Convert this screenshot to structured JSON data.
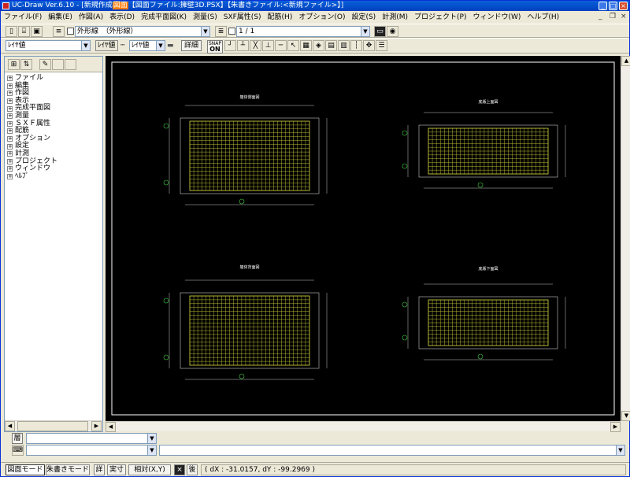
{
  "window": {
    "title_prefix": "UC-Draw Ver.6.10 - [新規作成",
    "title_highlight": "図面",
    "title_mid": "【図面ファイル:擁壁3D.PSX】【朱書きファイル:<新規ファイル>】]",
    "buttons": {
      "minimize": "_",
      "maximize": "□",
      "close": "×"
    }
  },
  "menubar": {
    "items": [
      "ファイル(F)",
      "編集(E)",
      "作図(A)",
      "表示(D)",
      "完成平面図(K)",
      "測量(S)",
      "SXF属性(S)",
      "配筋(H)",
      "オプション(O)",
      "設定(S)",
      "計測(M)",
      "プロジェクト(P)",
      "ウィンドウ(W)",
      "ヘルプ(H)"
    ],
    "mdi_buttons": [
      "_",
      "❐",
      "×"
    ]
  },
  "toolbar1": {
    "layer_combo": "外形線　（外形線）",
    "page_combo": "1 / 1"
  },
  "toolbar2": {
    "line_type_combo": "ﾚｲﾔ値",
    "label_layer": "ﾚｲﾔ値",
    "width_combo": "ﾚｲﾔ値",
    "detail_button": "詳細",
    "snap_label": "SNAP",
    "snap_state": "ON"
  },
  "tree": {
    "items": [
      "ファイル",
      "編集",
      "作図",
      "表示",
      "完成平面図",
      "測量",
      "ＳＸＦ属性",
      "配筋",
      "オプション",
      "設定",
      "計測",
      "プロジェクト",
      "ウィンドウ",
      "ﾍﾙﾌﾟ"
    ]
  },
  "drawing": {
    "views": [
      {
        "title": "躯体側面図"
      },
      {
        "title": "底版上面図"
      },
      {
        "title": "躯体背面図"
      },
      {
        "title": "底版下面図"
      }
    ],
    "colors": {
      "background": "#000000",
      "border": "#ffffff",
      "mesh": "#e0e040",
      "dimension": "#c8c8c8",
      "marker": "#40d040"
    }
  },
  "bottom": {
    "layer_label": "層",
    "combo1": "",
    "combo2": "",
    "combo3": ""
  },
  "statusbar": {
    "mode_drawing": "図面モード",
    "mode_markup": "朱書きモード",
    "detail": "詳",
    "actual": "実寸",
    "relative": "相対(X,Y)",
    "close_icon": "×",
    "after": "後",
    "coordinates": "( dX : -31.0157, dY : -99.2969 )"
  }
}
